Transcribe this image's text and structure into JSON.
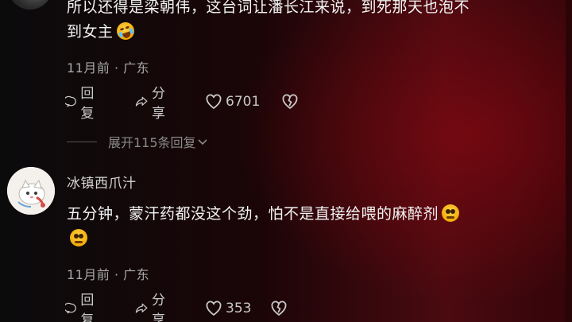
{
  "comments": [
    {
      "text_lines": [
        "所以还得是梁朝伟，这台词让潘长江来说，到死那天也泡不",
        "到女主"
      ],
      "time": "11月前",
      "location": "广东",
      "reply_label": "回复",
      "share_label": "分享",
      "like_count": "6701"
    },
    {
      "username": "冰镇西爪汁",
      "text_lines": [
        "五分钟，蒙汗药都没这个劲，怕不是直接给喂的麻醉剂",
        ""
      ],
      "time": "11月前",
      "location": "广东",
      "reply_label": "回复",
      "share_label": "分享",
      "like_count": "353"
    }
  ],
  "expand_replies_label": "展开115条回复",
  "icons": {
    "reply": "comment-bubble-icon",
    "share": "share-arrow-icon",
    "like": "heart-icon",
    "dislike": "broken-heart-icon",
    "expand": "chevron-down-icon",
    "emoji1": "rofl-emoji-icon",
    "emoji2": "pleading-emoji-icon"
  },
  "colors": {
    "background_dark": "#0b0b0c",
    "background_red": "#4a0a10",
    "text_primary": "#f4f4f4",
    "text_meta": "#a8a8a8",
    "action_gray": "#c9c9c9"
  }
}
